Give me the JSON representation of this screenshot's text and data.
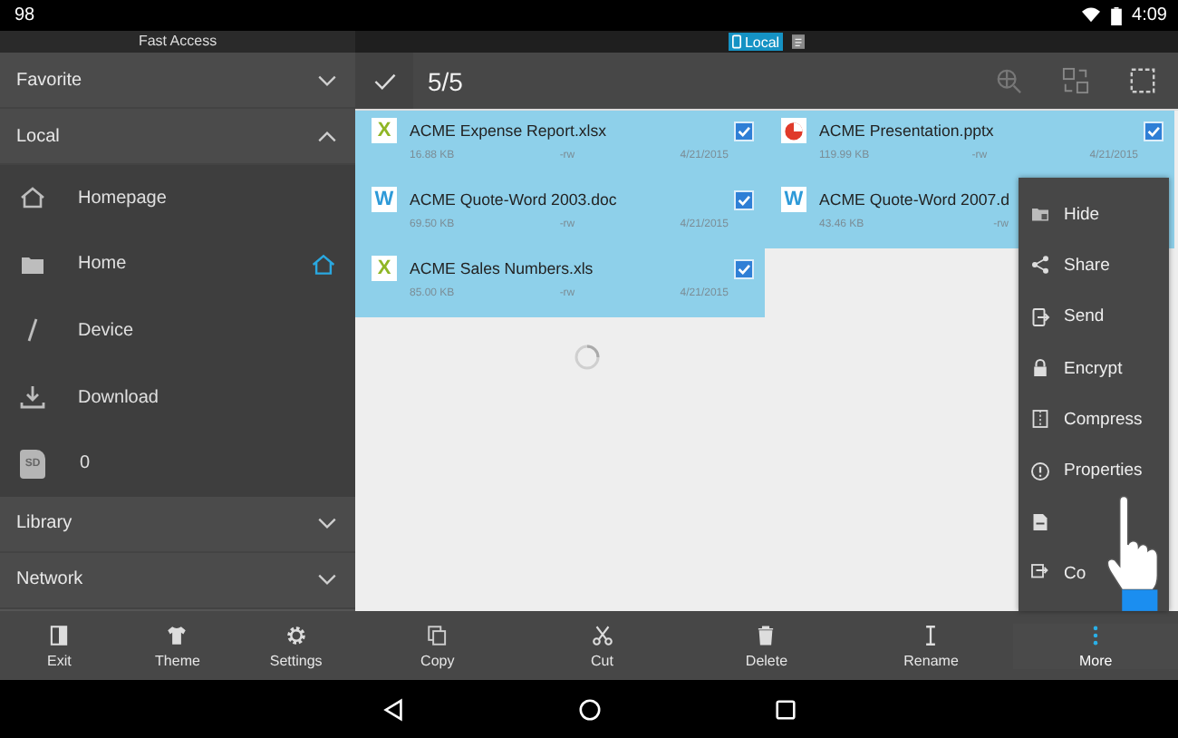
{
  "status_bar": {
    "notification": "98",
    "time": "4:09"
  },
  "sidebar": {
    "title": "Fast Access",
    "sections": [
      {
        "label": "Favorite",
        "expanded": false
      },
      {
        "label": "Local",
        "expanded": true,
        "items": [
          {
            "kind": "homepage",
            "label": "Homepage",
            "is_home": false
          },
          {
            "kind": "folder",
            "label": "Home",
            "is_home": true
          },
          {
            "kind": "root",
            "label": "Device",
            "is_home": false
          },
          {
            "kind": "download",
            "label": "Download",
            "is_home": false
          },
          {
            "kind": "sd",
            "icon_text": "SD",
            "label": "0",
            "is_home": false
          }
        ]
      },
      {
        "label": "Library",
        "expanded": false
      },
      {
        "label": "Network",
        "expanded": false
      }
    ],
    "buttons": [
      {
        "kind": "exit",
        "label": "Exit"
      },
      {
        "kind": "theme",
        "label": "Theme"
      },
      {
        "kind": "settings",
        "label": "Settings"
      }
    ]
  },
  "location_tabs": [
    {
      "label": "Local",
      "selected": true
    }
  ],
  "toolbar": {
    "count": "5/5"
  },
  "files": [
    {
      "kind": "excel",
      "badge": "X",
      "name": "ACME Expense Report.xlsx",
      "size": "16.88 KB",
      "permissions": "-rw",
      "date": "4/21/2015",
      "selected": true,
      "checked": true
    },
    {
      "kind": "presentation",
      "name": "ACME Presentation.pptx",
      "size": "119.99 KB",
      "permissions": "-rw",
      "date": "4/21/2015",
      "selected": true,
      "checked": true
    },
    {
      "kind": "word",
      "badge": "W",
      "name": "ACME Quote-Word 2003.doc",
      "size": "69.50 KB",
      "permissions": "-rw",
      "date": "4/21/2015",
      "selected": true,
      "checked": true
    },
    {
      "kind": "word",
      "badge": "W",
      "name": "ACME Quote-Word 2007.d",
      "size": "43.46 KB",
      "permissions": "-rw",
      "selected": true
    },
    {
      "kind": "excel",
      "badge": "X",
      "name": "ACME Sales Numbers.xls",
      "size": "85.00 KB",
      "permissions": "-rw",
      "date": "4/21/2015",
      "selected": true,
      "checked": true
    }
  ],
  "menu": [
    {
      "kind": "hide",
      "label": "Hide"
    },
    {
      "kind": "share",
      "label": "Share"
    },
    {
      "kind": "send",
      "label": "Send"
    },
    {
      "kind": "lock",
      "label": "Encrypt"
    },
    {
      "kind": "zip",
      "label": "Compress"
    },
    {
      "kind": "info",
      "label": "Properties"
    },
    {
      "kind": "export"
    },
    {
      "kind": "copyto",
      "label": "Co"
    }
  ],
  "actions": [
    {
      "kind": "copy",
      "label": "Copy",
      "active": false
    },
    {
      "kind": "cut",
      "label": "Cut",
      "active": false
    },
    {
      "kind": "delete",
      "label": "Delete",
      "active": false
    },
    {
      "kind": "rename",
      "label": "Rename",
      "active": false
    },
    {
      "kind": "more",
      "label": "More",
      "active": true
    }
  ]
}
